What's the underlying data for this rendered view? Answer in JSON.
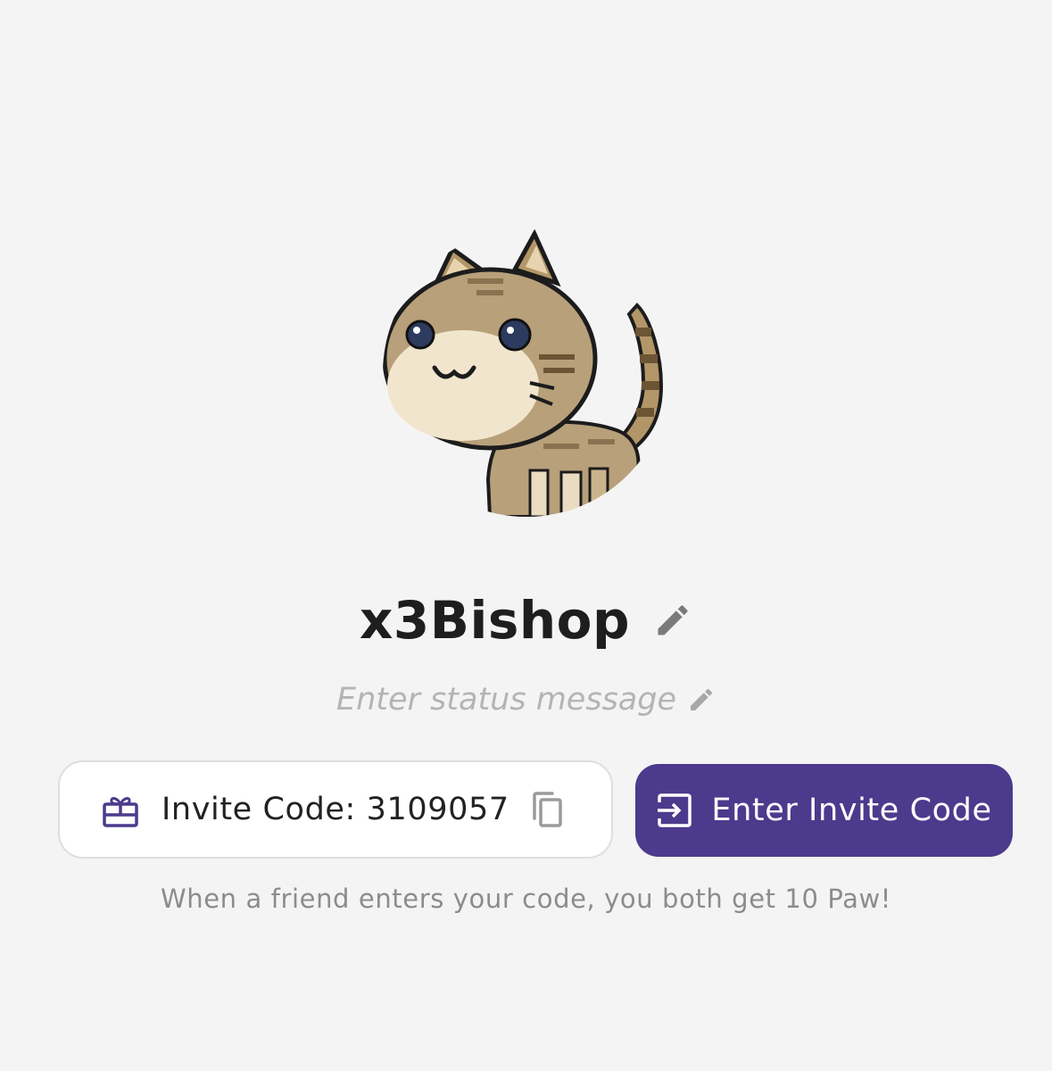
{
  "profile": {
    "avatar_alt": "pixel art cat avatar",
    "username": "x3Bishop",
    "status_placeholder": "Enter status message"
  },
  "invite": {
    "code_label": "Invite Code: 3109057",
    "enter_button_label": "Enter Invite Code",
    "hint": "When a friend enters your code, you both get 10 Paw!"
  },
  "icons": {
    "edit_name": "pencil-icon",
    "edit_status": "pencil-icon",
    "gift": "gift-icon",
    "copy": "copy-icon",
    "enter": "login-icon"
  },
  "colors": {
    "background": "#f4f4f4",
    "accent": "#4c3a8d",
    "username": "#1e1e1e",
    "placeholder": "#b4b4b4",
    "hint": "#8c8c8c"
  }
}
